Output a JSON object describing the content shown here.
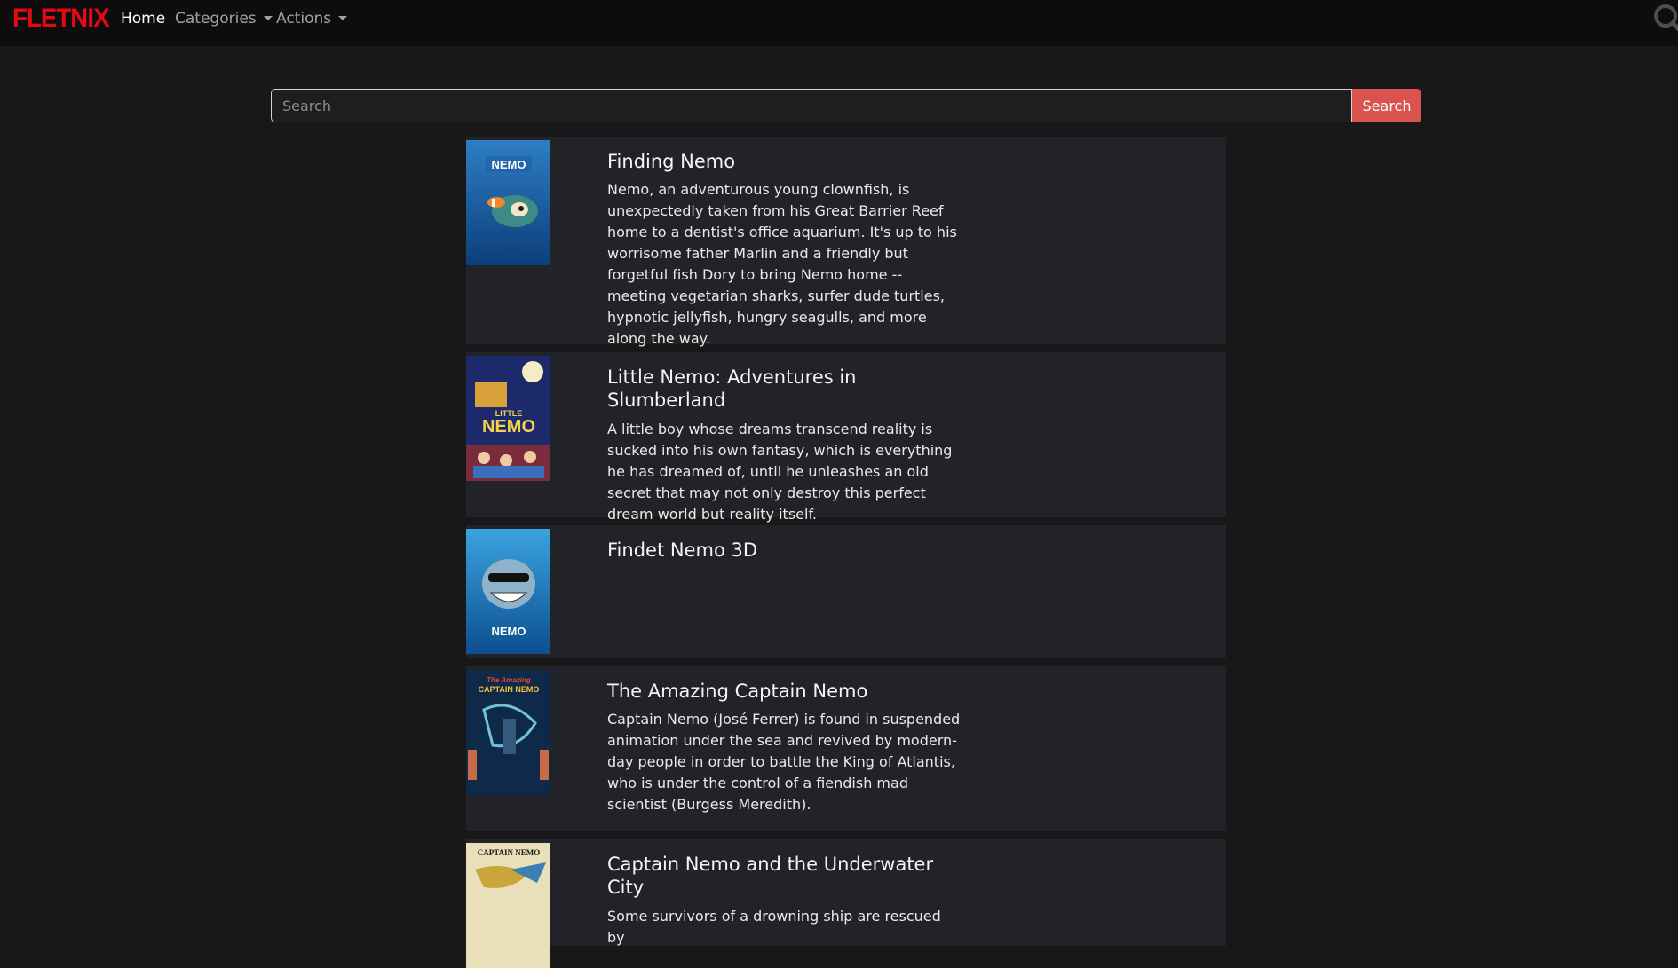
{
  "brand": {
    "name": "FLETNIX",
    "color": "#e50914"
  },
  "nav": {
    "home": "Home",
    "categories": "Categories",
    "actions": "Actions"
  },
  "search": {
    "placeholder": "Search",
    "value": "",
    "button_label": "Search",
    "button_color": "#d9534f"
  },
  "results": [
    {
      "title": "Finding Nemo",
      "description": "Nemo, an adventurous young clownfish, is unexpectedly taken from his Great Barrier Reef home to a dentist's office aquarium. It's up to his worrisome father Marlin and a friendly but forgetful fish Dory to bring Nemo home -- meeting vegetarian sharks, surfer dude turtles, hypnotic jellyfish, hungry seagulls, and more along the way.",
      "poster": "finding-nemo-poster"
    },
    {
      "title": "Little Nemo: Adventures in Slumberland",
      "description": "A little boy whose dreams transcend reality is sucked into his own fantasy, which is everything he has dreamed of, until he unleashes an old secret that may not only destroy this perfect dream world but reality itself.",
      "poster": "little-nemo-poster"
    },
    {
      "title": "Findet Nemo 3D",
      "description": "",
      "poster": "findet-nemo-3d-poster"
    },
    {
      "title": "The Amazing Captain Nemo",
      "description": "Captain Nemo (José Ferrer) is found in suspended animation under the sea and revived by modern-day people in order to battle the King of Atlantis, who is under the control of a fiendish mad scientist (Burgess Meredith).",
      "poster": "amazing-captain-nemo-poster"
    },
    {
      "title": "Captain Nemo and the Underwater City",
      "description": "Some survivors of a drowning ship are rescued by",
      "poster": "captain-nemo-underwater-city-poster"
    }
  ],
  "colors": {
    "background": "#181818",
    "navbar": "#0d0d0d",
    "card": "#212328"
  }
}
